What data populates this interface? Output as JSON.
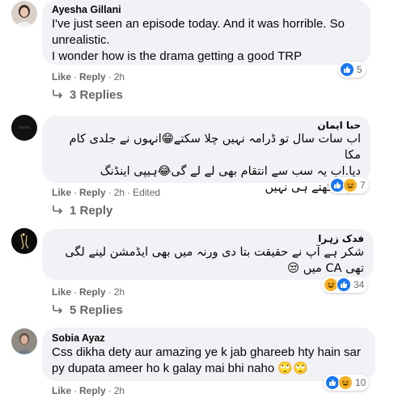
{
  "comments": [
    {
      "author": "Ayesha Gillani",
      "lines": [
        "I've just seen an episode today. And it was horrible. So",
        "unrealistic.",
        "I wonder how is the drama getting a good TRP"
      ],
      "actions": {
        "like": "Like",
        "reply": "Reply",
        "time": "2h"
      },
      "reactions": {
        "icons": [
          "like-icon"
        ],
        "count": "5"
      },
      "replies_label": "3 Replies"
    },
    {
      "author": "حبا ایمان",
      "lines": [
        "اب سات سال تو ڈرامہ نہیں چلا سکتے😁انہوں نے جلدی کام مکا",
        "دیا.اب یہ سب سے انتقام بھی لے لے گی😂ہیپی اینڈنگ",
        "ہم دیکھتے ہی نہیں"
      ],
      "actions": {
        "like": "Like",
        "reply": "Reply",
        "time": "2h",
        "edited": "Edited"
      },
      "reactions": {
        "icons": [
          "like-icon",
          "haha-icon"
        ],
        "count": "7"
      },
      "replies_label": "1 Reply"
    },
    {
      "author": "فدک زہرا",
      "lines": [
        "شکر ہے آپ نے حقیقت بتا دی ورنہ میں بھی ایڈمشن لینے لگی",
        "تھی CA میں 😒"
      ],
      "actions": {
        "like": "Like",
        "reply": "Reply",
        "time": "2h"
      },
      "reactions": {
        "icons": [
          "haha-icon",
          "like-icon"
        ],
        "count": "34"
      },
      "replies_label": "5 Replies"
    },
    {
      "author": "Sobia Ayaz",
      "lines": [
        "Css dikha dety aur amazing ye k jab ghareeb hty hain sar",
        "py dupata ameer ho k galay mai bhi naho 🙄🙄"
      ],
      "actions": {
        "like": "Like",
        "reply": "Reply",
        "time": "2h"
      },
      "reactions": {
        "icons": [
          "like-icon",
          "haha-icon"
        ],
        "count": "10"
      }
    }
  ]
}
